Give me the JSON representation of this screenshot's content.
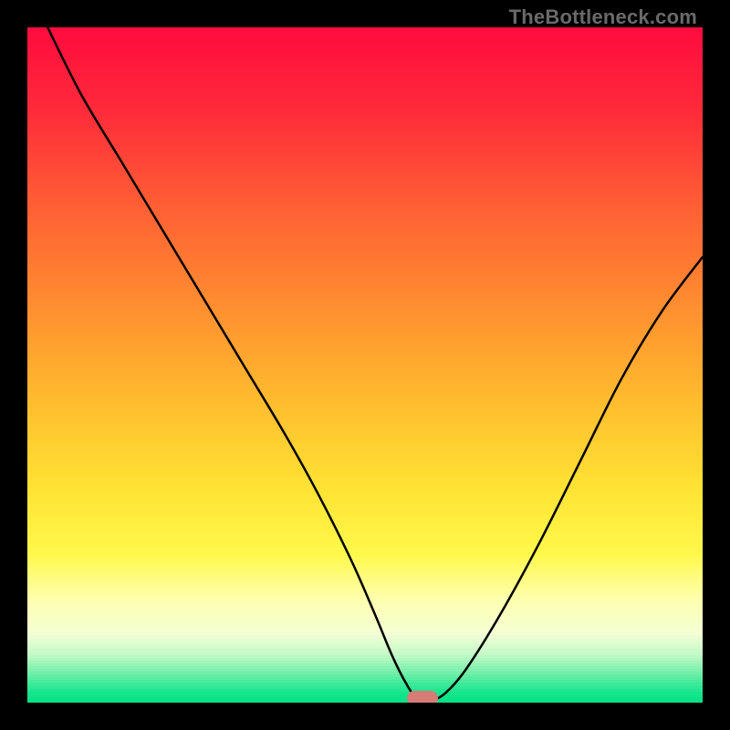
{
  "watermark": "TheBottleneck.com",
  "colors": {
    "frame": "#000000",
    "marker": "#d77b77",
    "curve": "#000000",
    "gradient_stops": [
      {
        "pct": 0,
        "color": "#ff0c3e"
      },
      {
        "pct": 12,
        "color": "#ff2a3a"
      },
      {
        "pct": 25,
        "color": "#ff5a35"
      },
      {
        "pct": 40,
        "color": "#ff8a30"
      },
      {
        "pct": 55,
        "color": "#ffbb2e"
      },
      {
        "pct": 68,
        "color": "#ffe233"
      },
      {
        "pct": 78,
        "color": "#fff84a"
      },
      {
        "pct": 85,
        "color": "#feffb0"
      },
      {
        "pct": 90,
        "color": "#f4ffd6"
      },
      {
        "pct": 93,
        "color": "#c4f9c7"
      },
      {
        "pct": 96,
        "color": "#6ceea6"
      },
      {
        "pct": 98.5,
        "color": "#1ae68e"
      },
      {
        "pct": 100,
        "color": "#07e286"
      }
    ]
  },
  "chart_data": {
    "type": "line",
    "title": "",
    "xlabel": "",
    "ylabel": "",
    "xlim": [
      0,
      100
    ],
    "ylim": [
      0,
      100
    ],
    "grid": false,
    "legend": false,
    "series": [
      {
        "name": "bottleneck-curve",
        "x": [
          3,
          8,
          14,
          20,
          26,
          32,
          38,
          43,
          48,
          51.5,
          54,
          56,
          57.5,
          60,
          62,
          65,
          70,
          76,
          82,
          88,
          94,
          100
        ],
        "y": [
          100,
          90,
          80,
          70,
          60,
          50,
          40,
          31,
          21,
          13,
          7,
          3,
          1,
          0.5,
          1.5,
          5,
          13,
          24,
          36,
          48,
          58,
          66
        ]
      }
    ],
    "annotations": [
      {
        "name": "optimal-marker",
        "x": 58.5,
        "y": 0.7
      }
    ]
  }
}
